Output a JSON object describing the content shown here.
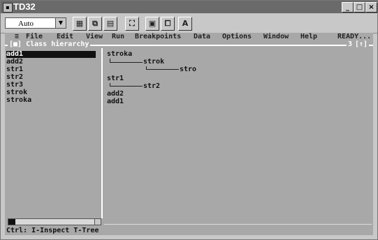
{
  "window": {
    "title": "TD32"
  },
  "toolbar": {
    "font_select_value": "Auto",
    "buttons": [
      "grid",
      "copy",
      "paste",
      "fullscreen",
      "windows",
      "windows-alt",
      "font-A"
    ]
  },
  "menu": {
    "system": "≡",
    "items": [
      "File",
      "Edit",
      "View",
      "Run",
      "Breakpoints",
      "Data",
      "Options",
      "Window",
      "Help"
    ],
    "status": "READY..."
  },
  "pane_header": {
    "close": "[■]",
    "title": "Class hierarchy",
    "window_number": "3",
    "arrows": "[↑]"
  },
  "class_list": [
    "add1",
    "add2",
    "str1",
    "str2",
    "str3",
    "strok",
    "stroka"
  ],
  "tree": {
    "nodes": [
      {
        "label": "stroka"
      },
      {
        "label": "strok"
      },
      {
        "label": "stro"
      },
      {
        "label": "str1"
      },
      {
        "label": "str2"
      },
      {
        "label": "add2"
      },
      {
        "label": "add1"
      }
    ]
  },
  "status_bar": "Ctrl: I-Inspect T-Tree"
}
